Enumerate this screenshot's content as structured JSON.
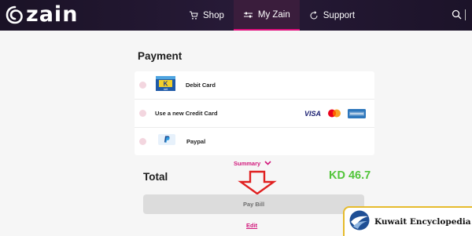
{
  "nav": {
    "brand": "zain",
    "items": [
      {
        "label": "Shop",
        "icon": "shopping-cart-icon"
      },
      {
        "label": "My Zain",
        "icon": "sliders-icon",
        "active": true
      },
      {
        "label": "Support",
        "icon": "refresh-icon"
      }
    ],
    "search_icon": "search-icon"
  },
  "payment": {
    "heading": "Payment",
    "options": [
      {
        "label": "Debit Card",
        "icon": "knet-icon",
        "icon_text": "K",
        "icon_subtext": "net"
      },
      {
        "label": "Use a new Credit Card",
        "brands": [
          "VISA",
          "mastercard",
          "american-express"
        ]
      },
      {
        "label": "Paypal",
        "icon": "paypal-icon"
      }
    ]
  },
  "summary": {
    "label": "Summary",
    "icon": "chevron-down-icon"
  },
  "total": {
    "label": "Total",
    "amount": "KD 46.7"
  },
  "annotation": {
    "icon": "down-arrow-icon",
    "color": "#e02020"
  },
  "actions": {
    "pay_label": "Pay Bill",
    "edit_label": "Edit"
  },
  "watermark": {
    "text": "Kuwait Encyclopedia"
  },
  "colors": {
    "accent": "#d1177b",
    "total_green": "#52c53a",
    "nav_bg": "#1f1530"
  }
}
